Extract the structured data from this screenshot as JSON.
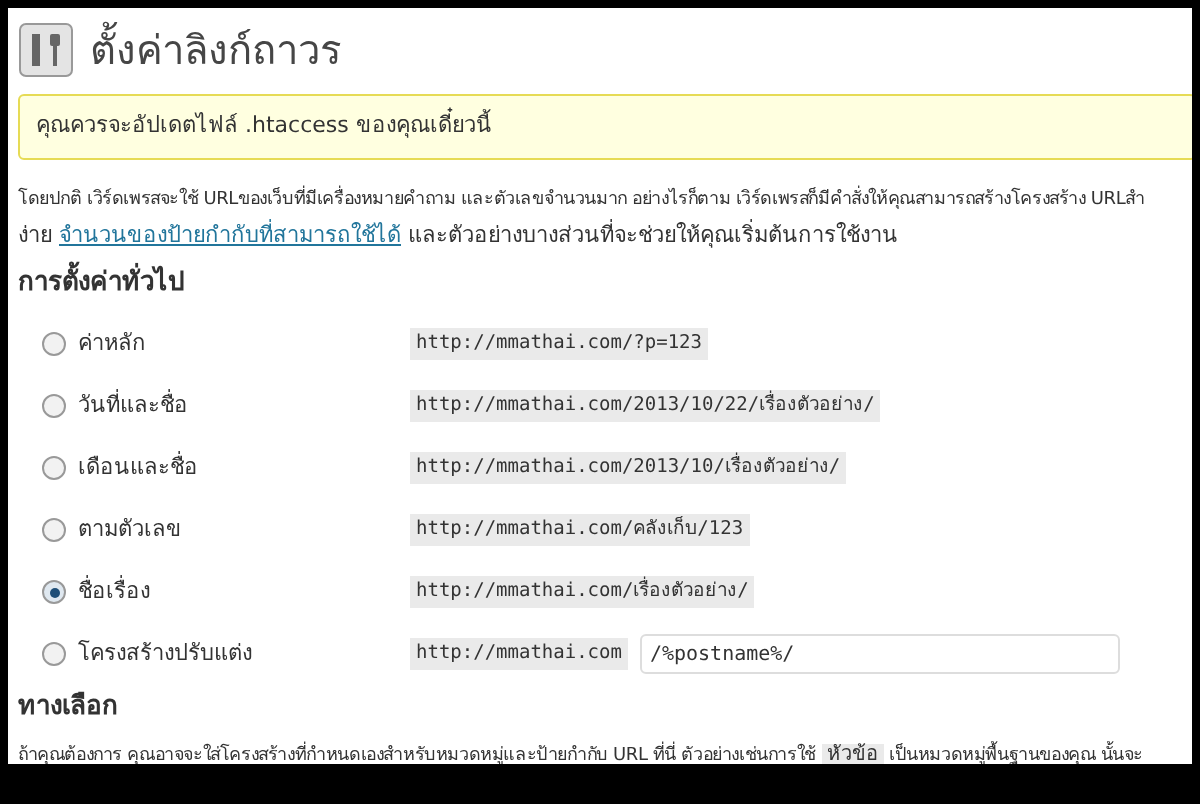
{
  "page_title": "ตั้งค่าลิงก์ถาวร",
  "notice": "คุณควรจะอัปเดตไฟล์ .htaccess ของคุณเดี๋ยวนี้",
  "intro": {
    "line1": "โดยปกติ เวิร์ดเพรสจะใช้ URLของเว็บที่มีเครื่องหมายคำถาม และตัวเลขจำนวนมาก อย่างไรก็ตาม เวิร์ดเพรสก็มีคำสั่งให้คุณสามารถสร้างโครงสร้าง URLสำ",
    "line2_before": "ง่าย",
    "link": "จำนวนของป้ายกำกับที่สามารถใช้ได้",
    "line2_after": "และตัวอย่างบางส่วนที่จะช่วยให้คุณเริ่มต้นการใช้งาน"
  },
  "general_heading": "การตั้งค่าทั่วไป",
  "options": [
    {
      "kind": "preset",
      "label": "ค่าหลัก",
      "example": "http://mmathai.com/?p=123",
      "selected": false
    },
    {
      "kind": "preset",
      "label": "วันที่และชื่อ",
      "example": "http://mmathai.com/2013/10/22/เรื่องตัวอย่าง/",
      "selected": false
    },
    {
      "kind": "preset",
      "label": "เดือนและชื่อ",
      "example": "http://mmathai.com/2013/10/เรื่องตัวอย่าง/",
      "selected": false
    },
    {
      "kind": "preset",
      "label": "ตามตัวเลข",
      "example": "http://mmathai.com/คลังเก็บ/123",
      "selected": false
    },
    {
      "kind": "preset",
      "label": "ชื่อเรื่อง",
      "example": "http://mmathai.com/เรื่องตัวอย่าง/",
      "selected": true
    },
    {
      "kind": "custom",
      "label": "โครงสร้างปรับแต่ง",
      "example": "http://mmathai.com",
      "value": "/%postname%/",
      "selected": false
    }
  ],
  "optional_heading": "ทางเลือก",
  "optional_text": {
    "before": "ถ้าคุณต้องการ คุณอาจจะใส่โครงสร้างที่กำหนดเองสำหรับหมวดหมู่และป้ายกำกับ URL ที่นี่ ตัวอย่างเช่นการใช้",
    "code": "หัวข้อ",
    "after": "เป็นหมวดหมู่พื้นฐานของคุณ นั้นจะ"
  }
}
